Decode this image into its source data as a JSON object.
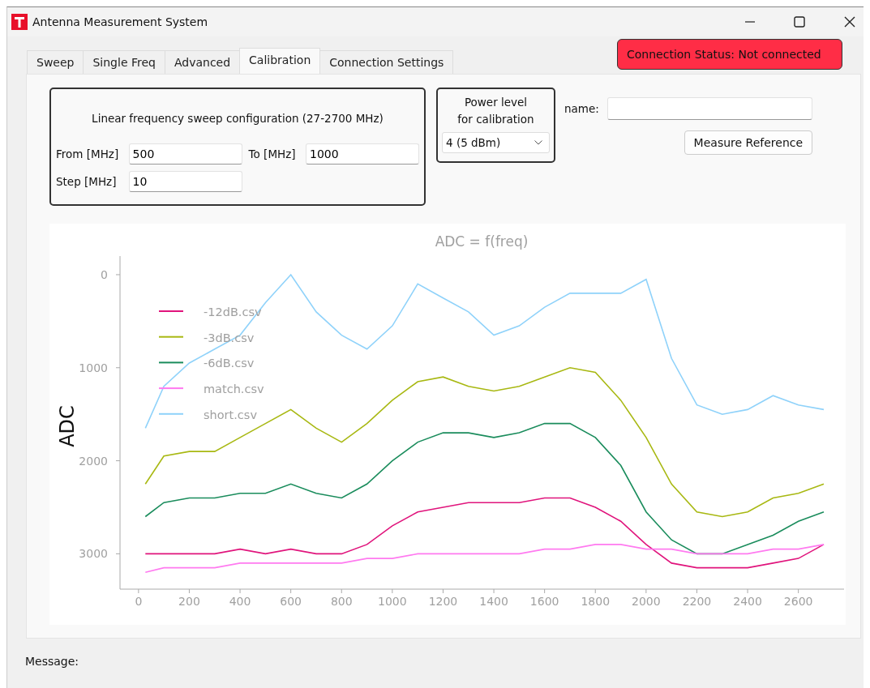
{
  "window": {
    "title": "Antenna Measurement System"
  },
  "tabs": [
    {
      "label": "Sweep",
      "selected": false
    },
    {
      "label": "Single Freq",
      "selected": false
    },
    {
      "label": "Advanced",
      "selected": false
    },
    {
      "label": "Calibration",
      "selected": true
    },
    {
      "label": "Connection Settings",
      "selected": false
    }
  ],
  "connection_status": {
    "text": "Connection Status:  Not connected",
    "connected": false
  },
  "sweep_config": {
    "title": "Linear frequency sweep configuration (27-2700 MHz)",
    "fields": [
      {
        "label": "From [MHz]",
        "value": "500"
      },
      {
        "label": "To [MHz]",
        "value": "1000"
      },
      {
        "label": "Step [MHz]",
        "value": "10"
      }
    ]
  },
  "power_level": {
    "title": "Power level\nfor calibration",
    "value": "4 (5 dBm)"
  },
  "name_field": {
    "label": "name:"
  },
  "measure_button": "Measure Reference",
  "chart": {
    "chart_data": {
      "type": "line",
      "title": "ADC = f(freq)",
      "ylabel": "ADC",
      "x": [
        27,
        100,
        200,
        300,
        400,
        500,
        600,
        700,
        800,
        900,
        1000,
        1100,
        1200,
        1300,
        1400,
        1500,
        1600,
        1700,
        1800,
        1900,
        2000,
        2100,
        2200,
        2300,
        2400,
        2500,
        2600,
        2700
      ],
      "series": [
        {
          "name": "-12dB.csv",
          "color": "#e0147c",
          "values": [
            3000,
            3000,
            3000,
            3000,
            2950,
            3000,
            2950,
            3000,
            3000,
            2900,
            2700,
            2550,
            2500,
            2450,
            2450,
            2450,
            2400,
            2400,
            2500,
            2650,
            2900,
            3100,
            3150,
            3150,
            3150,
            3100,
            3050,
            2900
          ]
        },
        {
          "name": "-3dB.csv",
          "color": "#a8b812",
          "values": [
            2250,
            1950,
            1900,
            1900,
            1750,
            1600,
            1450,
            1650,
            1800,
            1600,
            1350,
            1150,
            1100,
            1200,
            1250,
            1200,
            1100,
            1000,
            1050,
            1350,
            1750,
            2250,
            2550,
            2600,
            2550,
            2400,
            2350,
            2250
          ]
        },
        {
          "name": "-6dB.csv",
          "color": "#1a8c5c",
          "values": [
            2600,
            2450,
            2400,
            2400,
            2350,
            2350,
            2250,
            2350,
            2400,
            2250,
            2000,
            1800,
            1700,
            1700,
            1750,
            1700,
            1600,
            1600,
            1750,
            2050,
            2550,
            2850,
            3000,
            3000,
            2900,
            2800,
            2650,
            2550
          ]
        },
        {
          "name": "match.csv",
          "color": "#ff7af0",
          "values": [
            3200,
            3150,
            3150,
            3150,
            3100,
            3100,
            3100,
            3100,
            3100,
            3050,
            3050,
            3000,
            3000,
            3000,
            3000,
            3000,
            2950,
            2950,
            2900,
            2900,
            2950,
            2950,
            3000,
            3000,
            3000,
            2950,
            2950,
            2900
          ]
        },
        {
          "name": "short.csv",
          "color": "#8fd2fa",
          "values": [
            1650,
            1200,
            950,
            800,
            650,
            300,
            0,
            400,
            650,
            800,
            550,
            100,
            250,
            400,
            650,
            550,
            350,
            200,
            200,
            200,
            50,
            900,
            1400,
            1500,
            1450,
            1300,
            1400,
            1450
          ]
        }
      ],
      "legend": true,
      "xlim": [
        -73,
        2780
      ],
      "ylim": [
        3380,
        -200
      ],
      "xticks": [
        0,
        200,
        400,
        600,
        800,
        1000,
        1200,
        1400,
        1600,
        1800,
        2000,
        2200,
        2400,
        2600
      ],
      "yticks": [
        0,
        1000,
        2000,
        3000
      ]
    }
  },
  "status_bar": {
    "label": "Message:"
  }
}
